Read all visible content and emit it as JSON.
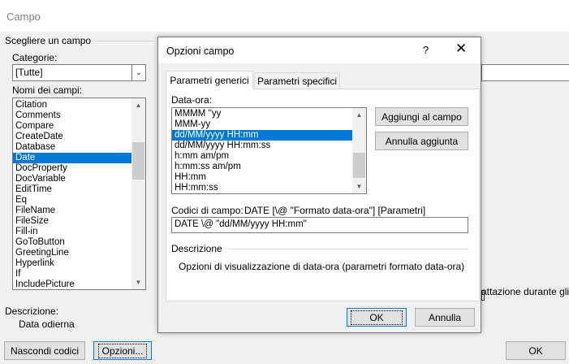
{
  "window": {
    "title": "Campo"
  },
  "left_panel": {
    "choose_field_heading": "Scegliere un campo",
    "categories_label": "Categorie:",
    "categories_value": "[Tutte]",
    "field_names_label": "Nomi dei campi:",
    "field_names": [
      "Citation",
      "Comments",
      "Compare",
      "CreateDate",
      "Database",
      "Date",
      "DocProperty",
      "DocVariable",
      "EditTime",
      "Eq",
      "FileName",
      "FileSize",
      "Fill-in",
      "GoToButton",
      "GreetingLine",
      "Hyperlink",
      "If",
      "IncludePicture"
    ],
    "selected_field": "Date",
    "description_label": "Descrizione:",
    "description_value": "Data odierna",
    "hide_codes_button": "Nascondi codici",
    "options_button": "Opzioni...",
    "ok_button": "OK",
    "partial_right_text": "attazione durante gli"
  },
  "dialog": {
    "title": "Opzioni campo",
    "help_glyph": "?",
    "close_glyph": "✕",
    "tabs": [
      {
        "label": "Parametri generici",
        "active": true
      },
      {
        "label": "Parametri specifici",
        "active": false
      }
    ],
    "date_time_label": "Data-ora:",
    "date_formats": [
      "MMMM ''yy",
      "MMM-yy",
      "dd/MM/yyyy HH:mm",
      "dd/MM/yyyy HH:mm:ss",
      "h:mm am/pm",
      "h:mm:ss am/pm",
      "HH:mm",
      "HH:mm:ss"
    ],
    "selected_format": "dd/MM/yyyy HH:mm",
    "add_field_button": "Aggiungi al campo",
    "undo_add_button": "Annulla aggiunta",
    "field_codes_label": "Codici di campo:",
    "field_codes_syntax": "DATE [\\@ \"Formato data-ora\"] [Parametri]",
    "field_code_value": "DATE \\@ \"dd/MM/yyyy HH:mm\"",
    "description_heading": "Descrizione",
    "description_text": "Opzioni di visualizzazione di data-ora (parametri formato data-ora)",
    "ok_button": "OK",
    "cancel_button": "Annulla"
  },
  "colors": {
    "accent": "#0078d7",
    "dialog_bg": "#f0f0f0",
    "selection": "#0078d7"
  }
}
